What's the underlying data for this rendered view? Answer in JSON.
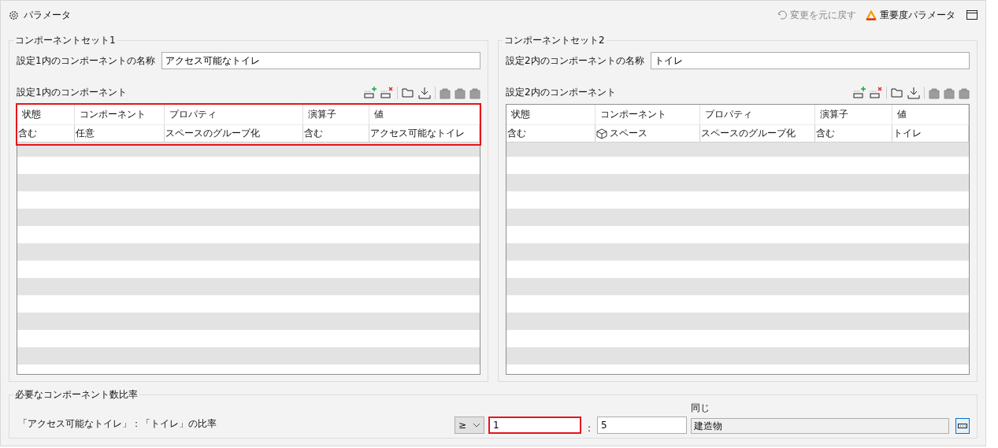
{
  "header": {
    "title": "パラメータ",
    "undo": {
      "label": "変更を元に戻す",
      "disabled": true
    },
    "importance": "重要度パラメータ"
  },
  "sets": [
    {
      "legend": "コンポーネントセット1",
      "name_label": "設定1内のコンポーネントの名称",
      "name_value": "アクセス可能なトイレ",
      "list_label": "設定1内のコンポーネント",
      "highlighted": true,
      "columns": [
        "状態",
        "コンポーネント",
        "プロパティ",
        "演算子",
        "値"
      ],
      "rows": [
        {
          "cells": [
            "含む",
            "任意",
            "スペースのグループ化",
            "含む",
            "アクセス可能なトイレ"
          ],
          "component_icon": false
        }
      ]
    },
    {
      "legend": "コンポーネントセット2",
      "name_label": "設定2内のコンポーネントの名称",
      "name_value": "トイレ",
      "list_label": "設定2内のコンポーネント",
      "highlighted": false,
      "columns": [
        "状態",
        "コンポーネント",
        "プロパティ",
        "演算子",
        "値"
      ],
      "rows": [
        {
          "cells": [
            "含む",
            "スペース",
            "スペースのグループ化",
            "含む",
            "トイレ"
          ],
          "component_icon": true
        }
      ]
    }
  ],
  "ratio": {
    "legend": "必要なコンポーネント数比率",
    "label": "「アクセス可能なトイレ」：「トイレ」の比率",
    "operator": "≥",
    "left_value": "1",
    "left_highlighted": true,
    "separator": ":",
    "right_value": "5",
    "same_label": "同じ",
    "same_value": "建造物"
  }
}
